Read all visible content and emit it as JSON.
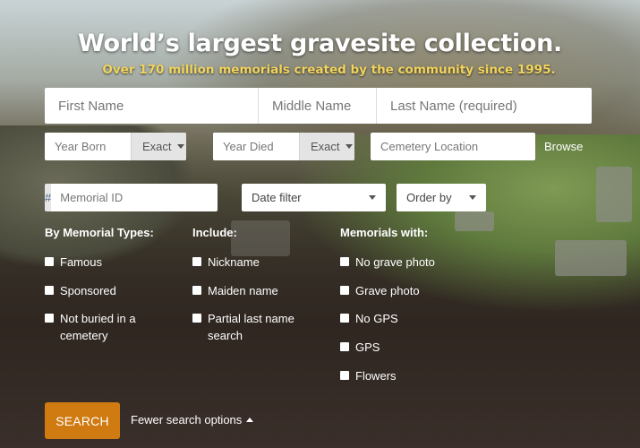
{
  "hero": {
    "title": "World’s largest gravesite collection.",
    "subtitle": "Over 170 million memorials created by the community since 1995."
  },
  "name_fields": {
    "first_placeholder": "First Name",
    "middle_placeholder": "Middle Name",
    "last_placeholder": "Last Name (required)"
  },
  "dates": {
    "year_born_placeholder": "Year Born",
    "year_born_match": "Exact",
    "year_died_placeholder": "Year Died",
    "year_died_match": "Exact"
  },
  "cemetery": {
    "location_placeholder": "Cemetery Location",
    "browse_label": "Browse"
  },
  "memorial": {
    "hash_symbol": "#",
    "id_placeholder": "Memorial ID"
  },
  "filters": {
    "date_filter": "Date filter",
    "order_by": "Order by"
  },
  "memorial_types": {
    "title": "By Memorial Types:",
    "items": [
      "Famous",
      "Sponsored",
      "Not buried in a cemetery"
    ]
  },
  "include": {
    "title": "Include:",
    "items": [
      "Nickname",
      "Maiden name",
      "Partial last name search"
    ]
  },
  "memorials_with": {
    "title": "Memorials with:",
    "items": [
      "No grave photo",
      "Grave photo",
      "No GPS",
      "GPS",
      "Flowers"
    ]
  },
  "actions": {
    "search_label": "SEARCH",
    "fewer_options_label": "Fewer search options"
  },
  "colors": {
    "accent": "#d07a12",
    "subtitle": "#f2d45c"
  }
}
